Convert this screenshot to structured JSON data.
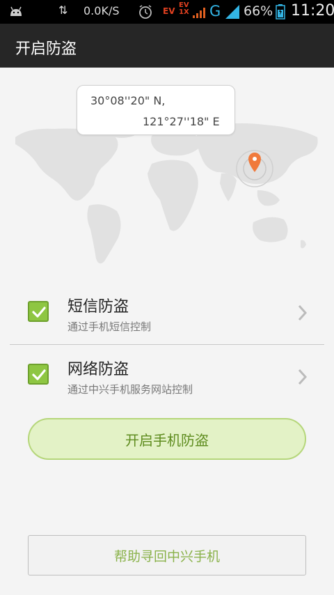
{
  "status_bar": {
    "network_speed": "0.0K/S",
    "ev_label_1": "EV",
    "ev_label_2": "EV",
    "ev_label_2b": "1X",
    "network_type": "G",
    "battery_percent": "66%",
    "time": "11:20",
    "icons": [
      "android-icon",
      "data-arrows-icon",
      "alarm-icon",
      "signal-icon",
      "battery-icon"
    ]
  },
  "header": {
    "title": "开启防盗"
  },
  "location": {
    "latitude": "30°08''20\" N,",
    "longitude": "121°27''18\" E",
    "marker_color": "#f07a3c"
  },
  "options": [
    {
      "label": "短信防盗",
      "description": "通过手机短信控制",
      "checked": true
    },
    {
      "label": "网络防盗",
      "description": "通过中兴手机服务网站控制",
      "checked": true
    }
  ],
  "buttons": {
    "enable_label": "开启手机防盗",
    "help_label": "帮助寻回中兴手机"
  },
  "colors": {
    "accent_green": "#8ec642",
    "title_bar": "#262626",
    "status_bar": "#000000"
  }
}
